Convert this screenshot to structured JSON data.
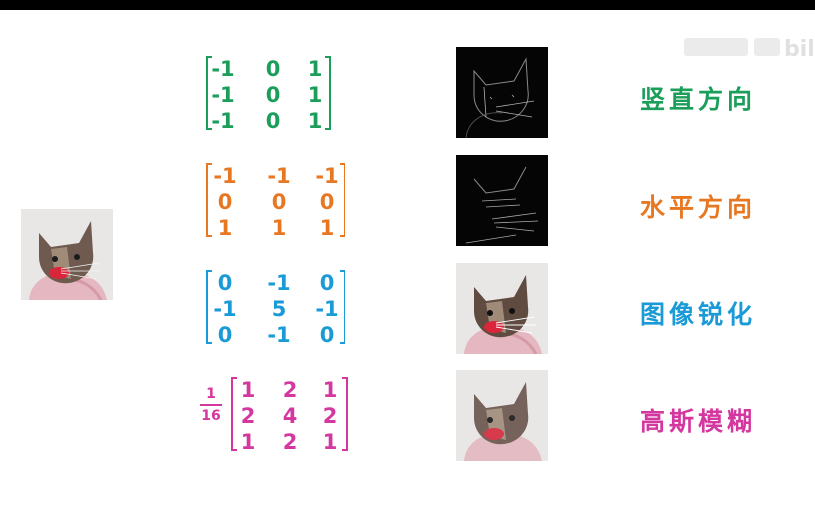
{
  "colors": {
    "vertical": "#1a9e5a",
    "horizontal": "#e87722",
    "sharpen": "#1a9ad6",
    "gaussian": "#d4379f"
  },
  "rows": [
    {
      "label": "竖直方向",
      "color": "#1a9e5a",
      "matrix": [
        [
          "-1",
          "0",
          "1"
        ],
        [
          "-1",
          "0",
          "1"
        ],
        [
          "-1",
          "0",
          "1"
        ]
      ],
      "output": "edge"
    },
    {
      "label": "水平方向",
      "color": "#e87722",
      "matrix": [
        [
          "-1",
          "-1",
          "-1"
        ],
        [
          "0",
          "0",
          "0"
        ],
        [
          "1",
          "1",
          "1"
        ]
      ],
      "output": "edge"
    },
    {
      "label": "图像锐化",
      "color": "#1a9ad6",
      "matrix": [
        [
          "0",
          "-1",
          "0"
        ],
        [
          "-1",
          "5",
          "-1"
        ],
        [
          "0",
          "-1",
          "0"
        ]
      ],
      "output": "photo"
    },
    {
      "label": "高斯模糊",
      "color": "#d4379f",
      "matrix": [
        [
          "1",
          "2",
          "1"
        ],
        [
          "2",
          "4",
          "2"
        ],
        [
          "1",
          "2",
          "1"
        ]
      ],
      "output": "photo"
    }
  ],
  "gaussian_factor": {
    "numerator": "1",
    "denominator": "16"
  },
  "watermark_icon": "bilibili-logo-icon"
}
